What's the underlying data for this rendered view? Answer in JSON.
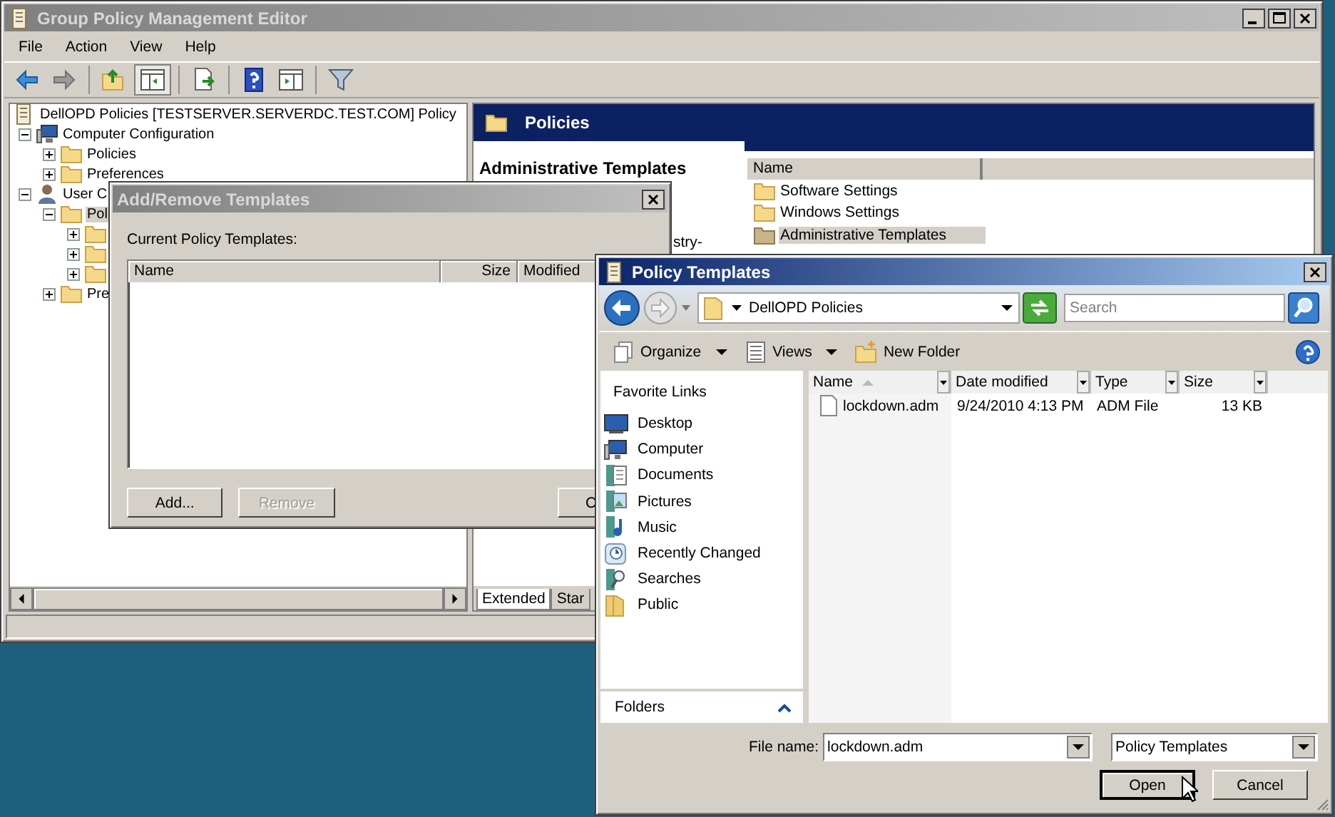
{
  "main_window": {
    "title": "Group Policy Management Editor",
    "menu": [
      "File",
      "Action",
      "View",
      "Help"
    ],
    "tree": [
      {
        "label": "DellOPD Policies [TESTSERVER.SERVERDC.TEST.COM] Policy",
        "kind": "policy",
        "selected": false,
        "children": [
          {
            "label": "Computer Configuration",
            "kind": "computer",
            "expanded": true,
            "selected": false,
            "children": [
              {
                "label": "Policies",
                "kind": "folder",
                "expanded": false,
                "selected": false
              },
              {
                "label": "Preferences",
                "kind": "folder",
                "expanded": false,
                "selected": false
              }
            ]
          },
          {
            "label": "User C",
            "kind": "user",
            "expanded": true,
            "selected": false,
            "children": [
              {
                "label": "Pol",
                "kind": "folder",
                "expanded": true,
                "selected": true,
                "children": [
                  {
                    "kind": "folder",
                    "expanded": false,
                    "selected": false
                  },
                  {
                    "kind": "folder",
                    "expanded": false,
                    "selected": false
                  },
                  {
                    "kind": "folder",
                    "expanded": false,
                    "selected": false
                  }
                ]
              },
              {
                "label": "Pre",
                "kind": "folder",
                "expanded": false,
                "selected": false
              }
            ]
          }
        ]
      }
    ],
    "details": {
      "header": "Policies",
      "description_title": "Administrative Templates",
      "description_fragment": "stry-",
      "columns": [
        "Name"
      ],
      "items": [
        {
          "label": "Software Settings",
          "selected": false
        },
        {
          "label": "Windows Settings",
          "selected": false
        },
        {
          "label": "Administrative Templates",
          "selected": true
        }
      ]
    },
    "tabs": [
      {
        "label": "Extended",
        "selected": true
      },
      {
        "label": "Star",
        "selected": false
      }
    ]
  },
  "add_remove_dialog": {
    "title": "Add/Remove Templates",
    "label": "Current Policy Templates:",
    "columns": [
      "Name",
      "Size",
      "Modified"
    ],
    "buttons": [
      {
        "label": "Add...",
        "disabled": false
      },
      {
        "label": "Remove",
        "disabled": true
      },
      {
        "label": "C",
        "disabled": false
      }
    ]
  },
  "file_dialog": {
    "title": "Policy Templates",
    "address": "DellOPD Policies",
    "search": {
      "placeholder": "Search"
    },
    "toolbar": [
      {
        "label": "Organize",
        "kind": "organize",
        "dropdown": true
      },
      {
        "label": "Views",
        "kind": "views",
        "dropdown": true
      },
      {
        "label": "New Folder",
        "kind": "new-folder",
        "dropdown": false
      }
    ],
    "favorite_links_title": "Favorite Links",
    "links": [
      {
        "label": "Desktop",
        "kind": "desktop"
      },
      {
        "label": "Computer",
        "kind": "computer"
      },
      {
        "label": "Documents",
        "kind": "documents"
      },
      {
        "label": "Pictures",
        "kind": "pictures"
      },
      {
        "label": "Music",
        "kind": "music"
      },
      {
        "label": "Recently Changed",
        "kind": "recent"
      },
      {
        "label": "Searches",
        "kind": "searches"
      },
      {
        "label": "Public",
        "kind": "public"
      }
    ],
    "folders_label": "Folders",
    "columns": [
      {
        "label": "Name",
        "sorted": true
      },
      {
        "label": "Date modified",
        "sorted": false
      },
      {
        "label": "Type",
        "sorted": false
      },
      {
        "label": "Size",
        "sorted": false
      }
    ],
    "files": [
      {
        "name": "lockdown.adm",
        "date_modified": "9/24/2010 4:13 PM",
        "type": "ADM File",
        "size": "13 KB"
      }
    ],
    "file_name_label": "File name:",
    "file_name": "lockdown.adm",
    "file_type": "Policy Templates",
    "buttons": [
      {
        "label": "Open",
        "default": true
      },
      {
        "label": "Cancel",
        "default": false
      }
    ]
  }
}
